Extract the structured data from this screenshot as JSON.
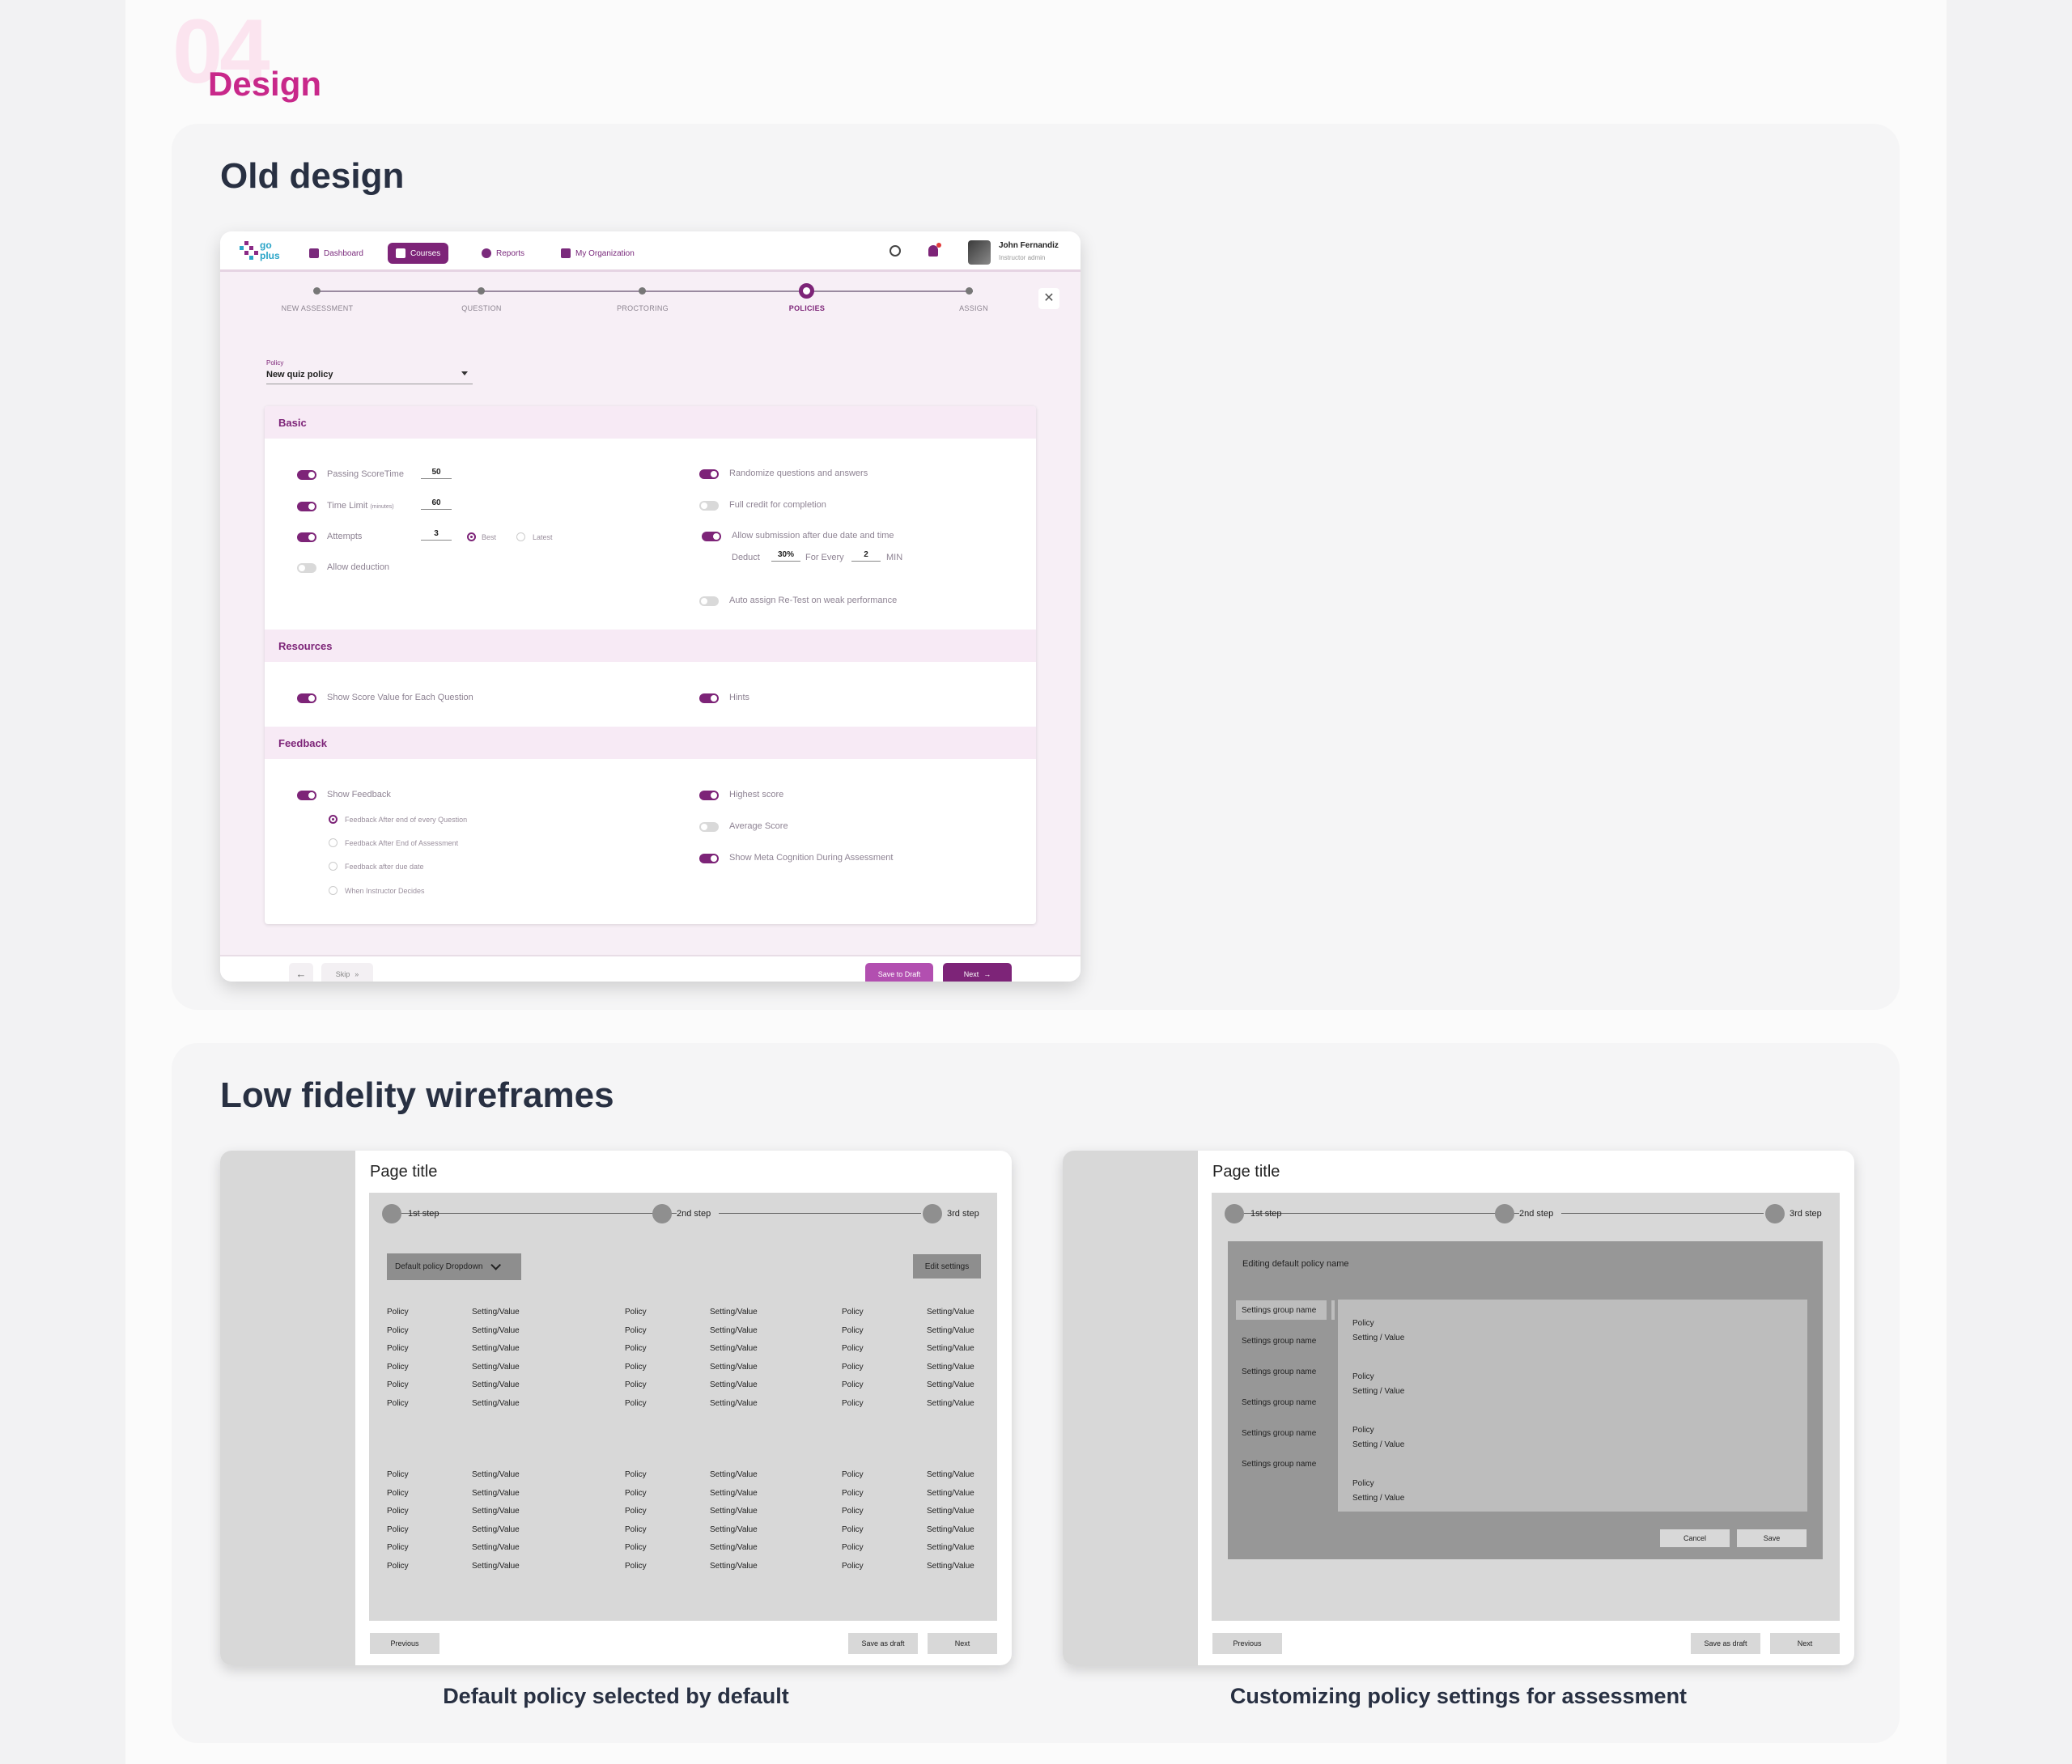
{
  "section": {
    "number": "04",
    "label": "Design"
  },
  "old_design": {
    "title": "Old design",
    "nav": {
      "logo_top": "go",
      "logo_bottom": "plus",
      "items": [
        {
          "label": "Dashboard",
          "active": false
        },
        {
          "label": "Courses",
          "active": true
        },
        {
          "label": "Reports",
          "active": false
        },
        {
          "label": "My Organization",
          "active": false
        }
      ],
      "user_name": "John Fernandiz",
      "user_role": "Instructor admin"
    },
    "steps": [
      "NEW ASSESSMENT",
      "QUESTION",
      "PROCTORING",
      "POLICIES",
      "ASSIGN"
    ],
    "current_step": 3,
    "policy": {
      "label": "Policy",
      "value": "New quiz policy"
    },
    "basic": {
      "heading": "Basic",
      "passing_label": "Passing ScoreTime",
      "passing_value": "50",
      "time_label": "Time Limit",
      "time_unit": "(minutes)",
      "time_value": "60",
      "attempts_label": "Attempts",
      "attempts_value": "3",
      "best_label": "Best",
      "latest_label": "Latest",
      "deduction_label": "Allow deduction",
      "randomize_label": "Randomize questions and answers",
      "full_credit_label": "Full credit for completion",
      "late_submission_label": "Allow submission after due date and time",
      "deduct_label": "Deduct",
      "deduct_value": "30%",
      "for_every_label": "For Every",
      "for_every_value": "2",
      "min_label": "MIN",
      "auto_assign_label": "Auto assign Re-Test on weak performance"
    },
    "resources": {
      "heading": "Resources",
      "score_value_label": "Show Score Value for Each Question",
      "hints_label": "Hints"
    },
    "feedback": {
      "heading": "Feedback",
      "show_feedback_label": "Show Feedback",
      "options": [
        "Feedback After end of every Question",
        "Feedback After End of Assessment",
        "Feedback after due date",
        "When Instructor Decides"
      ],
      "selected_option": 0,
      "highest_label": "Highest score",
      "average_label": "Average Score",
      "meta_label": "Show Meta Cognition During Assessment"
    },
    "footer": {
      "skip": "Skip",
      "draft": "Save to Draft",
      "next": "Next"
    }
  },
  "wireframes": {
    "title": "Low fidelity wireframes",
    "page_title": "Page title",
    "steps": [
      "1st step",
      "2nd step",
      "3rd step"
    ],
    "left": {
      "dropdown": "Default policy Dropdown",
      "edit": "Edit settings",
      "policy_cell": "Policy",
      "value_cell": "Setting/Value",
      "caption": "Default policy selected by default"
    },
    "right": {
      "modal_title": "Editing default policy name",
      "group": "Settings group name",
      "policy_cell": "Policy",
      "value_cell": "Setting / Value",
      "cancel": "Cancel",
      "save": "Save",
      "caption": "Customizing policy settings for assessment"
    },
    "buttons": {
      "previous": "Previous",
      "draft": "Save as draft",
      "next": "Next"
    }
  }
}
